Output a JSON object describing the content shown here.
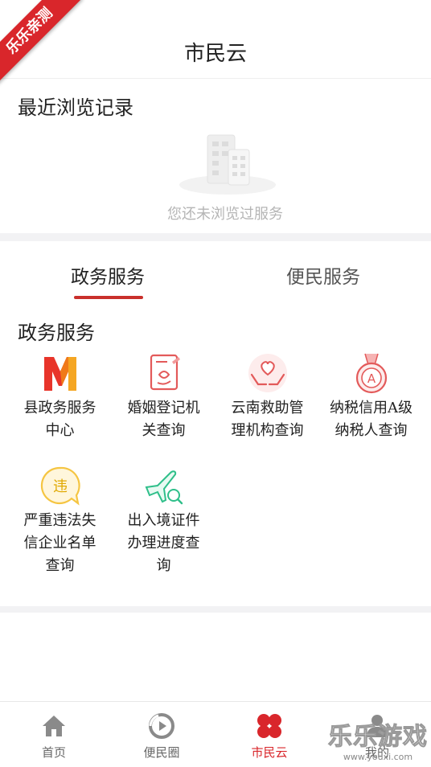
{
  "ribbon": {
    "label": "乐乐亲测"
  },
  "header": {
    "title": "市民云"
  },
  "recent": {
    "title": "最近浏览记录",
    "empty_text": "您还未浏览过服务"
  },
  "tabs": [
    {
      "label": "政务服务",
      "active": true
    },
    {
      "label": "便民服务",
      "active": false
    }
  ],
  "section": {
    "title": "政务服务"
  },
  "services": [
    {
      "label_line1": "县政务服务",
      "label_line2": "中心",
      "label_line3": "",
      "icon": "county-service-center-icon"
    },
    {
      "label_line1": "婚姻登记机",
      "label_line2": "关查询",
      "label_line3": "",
      "icon": "marriage-registration-icon"
    },
    {
      "label_line1": "云南救助管",
      "label_line2": "理机构查询",
      "label_line3": "",
      "icon": "relief-agency-icon"
    },
    {
      "label_line1": "纳税信用A级",
      "label_line2": "纳税人查询",
      "label_line3": "",
      "icon": "tax-credit-medal-icon"
    },
    {
      "label_line1": "严重违法失",
      "label_line2": "信企业名单",
      "label_line3": "查询",
      "icon": "violation-list-icon"
    },
    {
      "label_line1": "出入境证件",
      "label_line2": "办理进度查",
      "label_line3": "询",
      "icon": "entry-exit-plane-icon"
    }
  ],
  "tabbar": [
    {
      "label": "首页",
      "icon": "home-icon",
      "active": false
    },
    {
      "label": "便民圈",
      "icon": "circle-play-icon",
      "active": false
    },
    {
      "label": "市民云",
      "icon": "clover-icon",
      "active": true
    },
    {
      "label": "我的",
      "icon": "user-icon",
      "active": false
    }
  ],
  "watermark": {
    "text": "乐乐游戏",
    "url": "www.youxi.com"
  },
  "colors": {
    "accent": "#d9262b",
    "underline": "#c9302c",
    "muted": "#b5b5b5"
  }
}
